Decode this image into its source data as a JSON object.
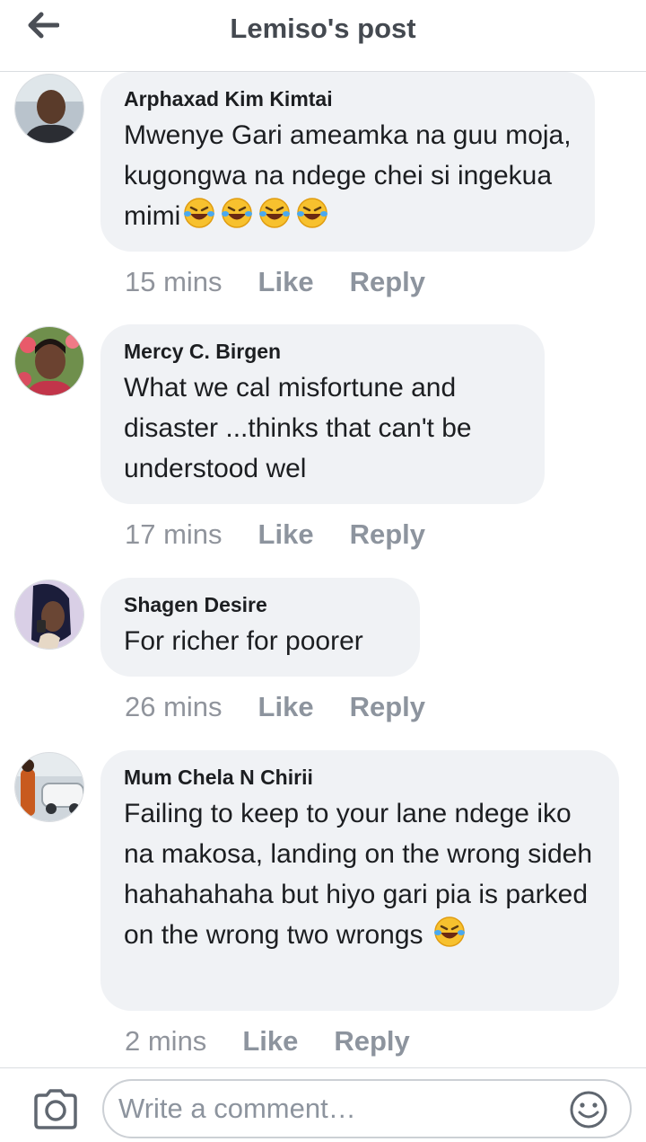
{
  "header": {
    "title": "Lemiso's post",
    "back_icon": "arrow-left-icon"
  },
  "comments": [
    {
      "author": "Arphaxad Kim Kimtai",
      "text": "Mwenye Gari ameamka na guu moja, kugongwa na ndege chei si ingekua mimi",
      "emoji_count": 4,
      "time": "15 mins",
      "like_label": "Like",
      "reply_label": "Reply"
    },
    {
      "author": "Mercy C. Birgen",
      "text": "What we cal misfortune and disaster ...thinks that can't be understood wel",
      "time": "17 mins",
      "like_label": "Like",
      "reply_label": "Reply"
    },
    {
      "author": "Shagen Desire",
      "text": "For richer for poorer",
      "time": "26 mins",
      "like_label": "Like",
      "reply_label": "Reply"
    },
    {
      "author": "Mum Chela N Chirii",
      "text": "Failing to keep to your lane ndege iko na makosa, landing on the wrong sideh hahahahaha but hiyo gari pia is parked on the wrong two wrongs",
      "emoji_count": 1,
      "time": "2 mins",
      "like_label": "Like",
      "reply_label": "Reply"
    }
  ],
  "composer": {
    "placeholder": "Write a comment…",
    "camera_icon": "camera-icon",
    "emoji_icon": "smiley-icon"
  },
  "colors": {
    "bubble": "#f0f2f5",
    "meta_text": "#8d949e",
    "header_title": "#444950"
  }
}
